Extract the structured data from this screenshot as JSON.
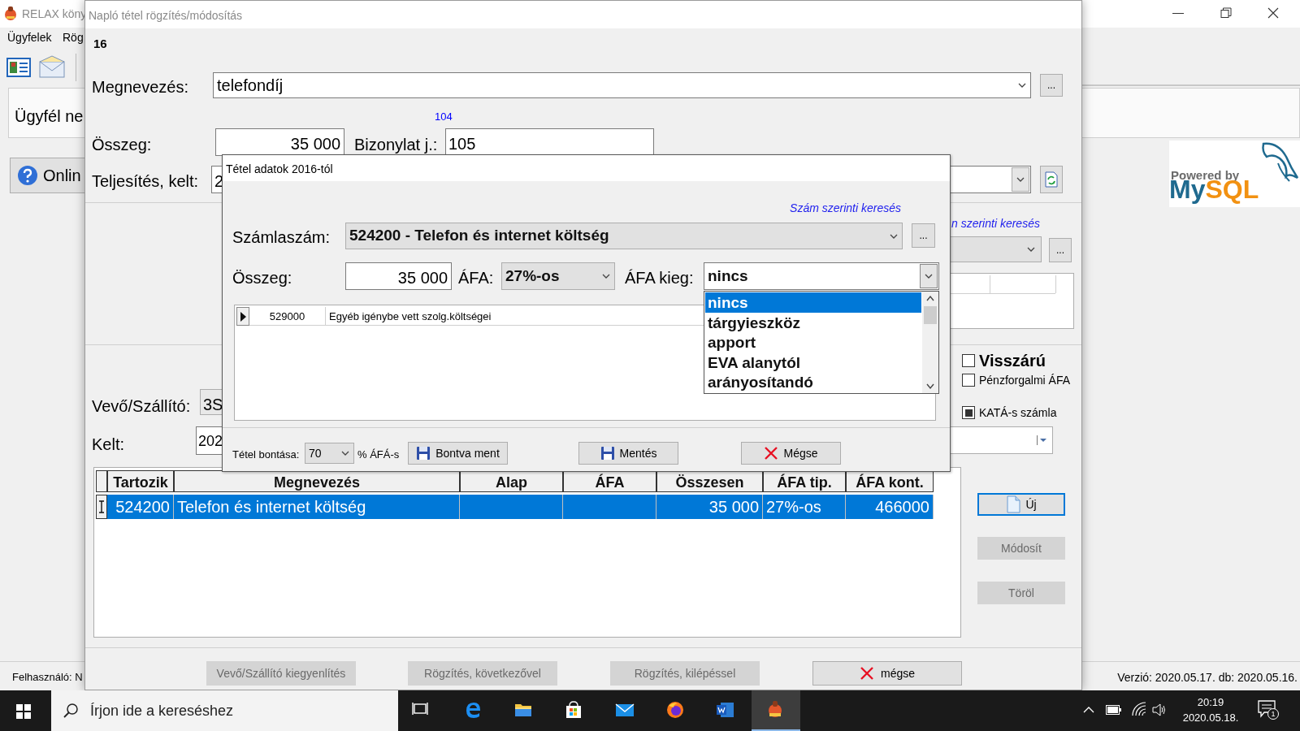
{
  "main_window": {
    "title": "RELAX köny",
    "menu": [
      "Ügyfelek",
      "Rög"
    ],
    "customer_label": "Ügyfél ne",
    "online_button": "Onlin",
    "user_label": "Felhasználó: N",
    "version": "Verzió: 2020.05.17. db: 2020.05.16.",
    "logo": {
      "caption": "Powered by",
      "name_part_1": "My",
      "name_part_2": "SQL"
    }
  },
  "dialog": {
    "title": "Napló tétel rögzítés/módosítás",
    "number": "16",
    "megnevezes": {
      "label": "Megnevezés:",
      "value": "telefondíj",
      "button": "..."
    },
    "counter": "104",
    "osszeg": {
      "label": "Összeg:",
      "value": "35 000"
    },
    "bizonylat": {
      "label": "Bizonylat j.:",
      "value": "105"
    },
    "teljesites": {
      "label": "Teljesítés, kelt:",
      "value": "2"
    },
    "search_link": "n szerinti keresés",
    "button_2": "...",
    "checkboxes": [
      {
        "label": "Visszárú",
        "checked": false
      },
      {
        "label": "Pénzforgalmi ÁFA",
        "checked": false
      },
      {
        "label": "KATÁ-s számla",
        "checked": true
      }
    ],
    "vevo": {
      "label": "Vevő/Szállító:",
      "value": "3S"
    },
    "kelt": {
      "label": "Kelt:",
      "value": "202"
    },
    "table": {
      "columns": [
        "Tartozik",
        "Megnevezés",
        "Alap",
        "ÁFA",
        "Összesen",
        "ÁFA tip.",
        "ÁFA kont."
      ],
      "rows": [
        {
          "selected": true,
          "tartozik": "524200",
          "megnevezes": "Telefon és internet költség",
          "osszesen": "35 000",
          "afa_tip": "27%-os",
          "afa_kont": "466000"
        }
      ]
    },
    "side_buttons": [
      {
        "label": "Új",
        "kind": "new",
        "disabled": false
      },
      {
        "label": "Módosít",
        "kind": "plain",
        "disabled": true
      },
      {
        "label": "Töröl",
        "kind": "plain",
        "disabled": true
      }
    ],
    "bottom_buttons": [
      {
        "label": "Vevő/Szállító kiegyenlítés",
        "kind": "plain",
        "disabled": true
      },
      {
        "label": "Rögzítés, következővel",
        "kind": "plain",
        "disabled": true
      },
      {
        "label": "Rögzítés, kilépéssel",
        "kind": "plain",
        "disabled": true
      },
      {
        "label": "mégse",
        "kind": "cancel",
        "disabled": false
      }
    ]
  },
  "popup": {
    "title": "Tétel adatok 2016-tól",
    "search_link": "Szám szerinti keresés",
    "szamlaszam": {
      "label": "Számlaszám:",
      "value": "524200 - Telefon és internet költség",
      "button": "..."
    },
    "osszeg": {
      "label": "Összeg:",
      "value": "35 000"
    },
    "afa": {
      "label": "ÁFA:",
      "value": "27%-os"
    },
    "afa_kieg": {
      "label": "ÁFA kieg:",
      "value": "nincs",
      "expanded": true,
      "options": [
        {
          "label": "nincs",
          "selected": true
        },
        {
          "label": "tárgyieszköz",
          "selected": false
        },
        {
          "label": "apport",
          "selected": false
        },
        {
          "label": "EVA alanytól",
          "selected": false
        },
        {
          "label": "arányosítandó",
          "selected": false
        }
      ]
    },
    "grid": {
      "rows": [
        {
          "current": true,
          "code": "529000",
          "name": "Egyéb igénybe vett szolg.költségei"
        }
      ]
    },
    "split": {
      "label": "Tétel bontása:",
      "value": "70",
      "suffix": "% ÁFÁ-s"
    },
    "buttons": [
      {
        "label": "Bontva ment",
        "kind": "save"
      },
      {
        "label": "Mentés",
        "kind": "save"
      },
      {
        "label": "Mégse",
        "kind": "cancel"
      }
    ]
  },
  "taskbar": {
    "search_placeholder": "Írjon ide a kereséshez",
    "apps": [
      {
        "kind": "taskview",
        "selected": false
      },
      {
        "kind": "edge",
        "selected": false
      },
      {
        "kind": "explorer",
        "selected": false
      },
      {
        "kind": "store",
        "selected": false
      },
      {
        "kind": "mail",
        "selected": false
      },
      {
        "kind": "firefox",
        "selected": false
      },
      {
        "kind": "word",
        "selected": false
      },
      {
        "kind": "relax",
        "selected": true
      }
    ],
    "time": "20:19",
    "date": "2020.05.18.",
    "notifications": "1"
  }
}
